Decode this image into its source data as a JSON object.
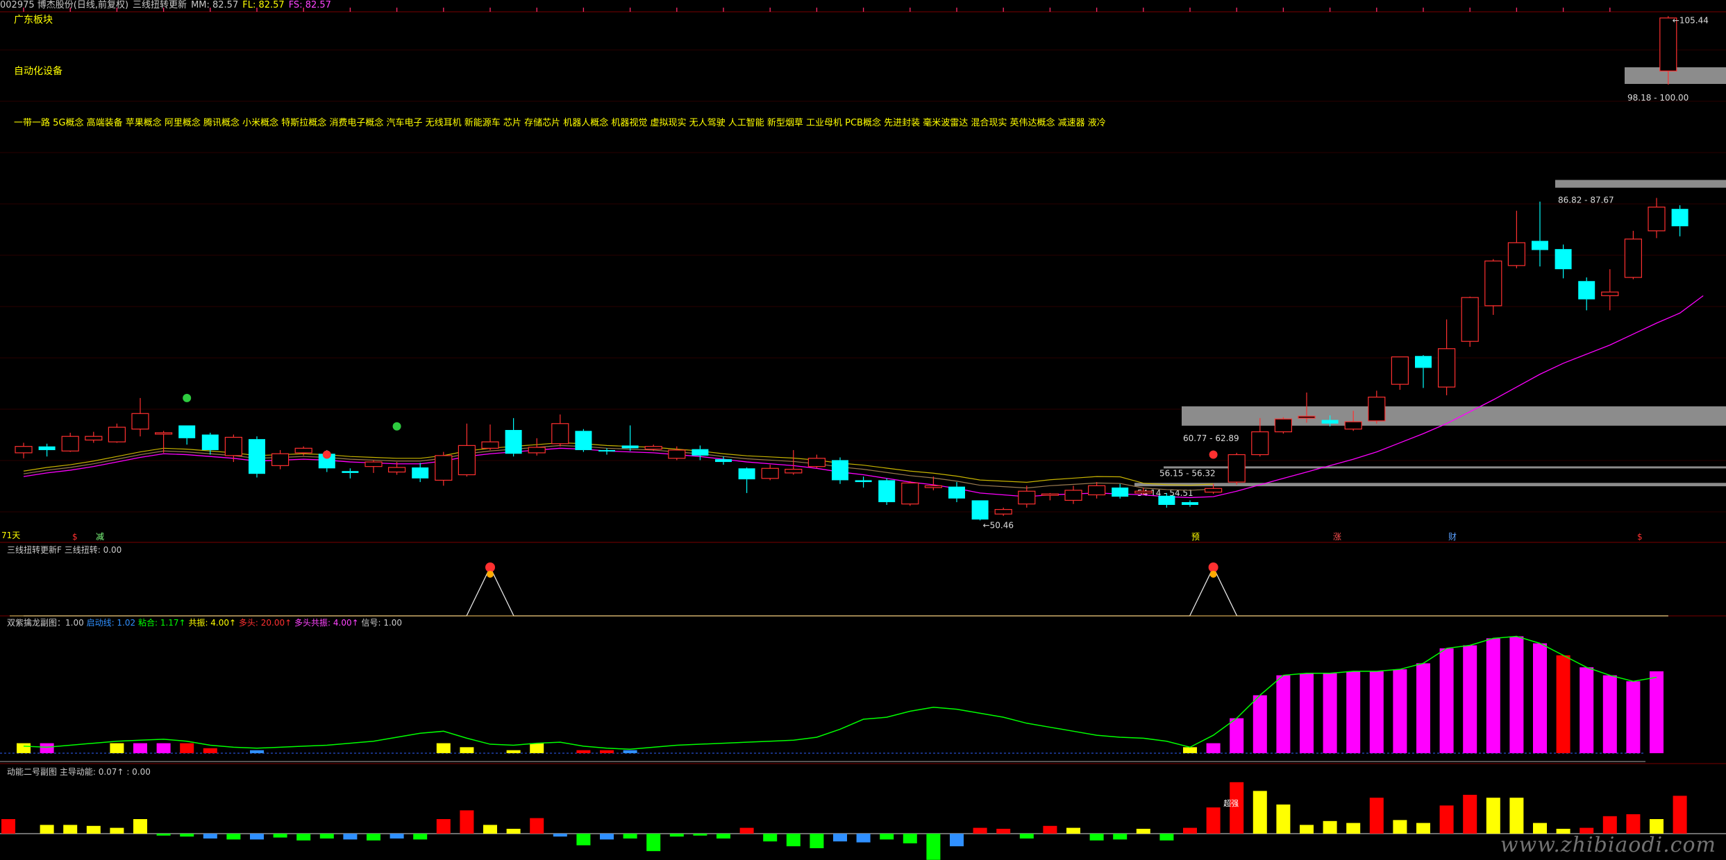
{
  "header": {
    "stock": "002975 博杰股份(日线,前复权)",
    "indicator": "三线扭转更新",
    "mm": "MM: 82.57",
    "fl": "FL: 82.57",
    "fs": "FS: 82.57",
    "arrow": "↑"
  },
  "tags": {
    "region": "广东板块",
    "industry": "自动化设备",
    "concepts": "一带一路 5G概念 高端装备 苹果概念 阿里概念 腾讯概念 小米概念 特斯拉概念 消费电子概念 汽车电子 无线耳机 新能源车 芯片 存储芯片 机器人概念 机器视觉 虚拟现实 无人驾驶 人工智能 新型烟草 工业母机 PCB概念 先进封装 毫米波雷达 混合现实 英伟达概念 减速器 液冷"
  },
  "price_labels": {
    "high": "105.44",
    "low": "50.46",
    "zone1": "98.18 - 100.00",
    "zone2": "86.82 - 87.67",
    "zone3": "60.77 - 62.89",
    "zone4": "56.15 - 56.32",
    "zone5": "54.14 - 54.51"
  },
  "event_labels": {
    "left": "71天",
    "e1": "$",
    "e2": "减",
    "e3": "预",
    "e4": "涨",
    "e5": "财",
    "e6": "$"
  },
  "panels": {
    "p2": {
      "name": "三线扭转更新F",
      "value": "三线扭转: 0.00"
    },
    "p3": {
      "name": "双紫擒龙副图：1.00",
      "a": "启动线: 1.02",
      "b": "粘合: 1.17↑",
      "c": "共振: 4.00↑",
      "d": "多头: 20.00↑",
      "e": "多头共振: 4.00↑",
      "f": "信号: 1.00"
    },
    "p4": {
      "name": "动能二号副图",
      "a": "主导动能: 0.07↑",
      "b": ": 0.00",
      "mark": "超强"
    }
  },
  "watermark": "www.zhibiaodi.com",
  "colors": {
    "up": "#ff3030",
    "down": "#00ffff",
    "ma": "#ff00ff",
    "yellow": "#ffff00",
    "green": "#00ff00",
    "magenta": "#ff00ff",
    "red": "#ff0000",
    "blue": "#3090ff",
    "zone": "#8c8c8c"
  },
  "chart_data": [
    {
      "type": "candlestick",
      "title": "002975 博杰股份(日线,前复权)",
      "ylim": [
        48,
        106
      ],
      "candles": [
        [
          57.8,
          58.5,
          57.2,
          58.9
        ],
        [
          58.5,
          58.1,
          57.4,
          58.8
        ],
        [
          58.0,
          59.6,
          57.9,
          60.0
        ],
        [
          59.2,
          59.6,
          58.9,
          60.1
        ],
        [
          59.0,
          60.6,
          58.9,
          61.0
        ],
        [
          60.4,
          62.1,
          59.6,
          63.8
        ],
        [
          59.9,
          60.0,
          57.8,
          60.2
        ],
        [
          60.8,
          59.4,
          58.7,
          60.8
        ],
        [
          59.8,
          58.1,
          57.6,
          60.0
        ],
        [
          57.5,
          59.5,
          56.8,
          59.8
        ],
        [
          59.3,
          55.5,
          55.1,
          59.6
        ],
        [
          56.4,
          57.7,
          56.0,
          58.1
        ],
        [
          57.8,
          58.3,
          57.5,
          58.5
        ],
        [
          57.7,
          56.1,
          55.7,
          58.1
        ],
        [
          55.8,
          55.6,
          55.0,
          56.1
        ],
        [
          56.3,
          56.8,
          55.6,
          57.0
        ],
        [
          55.7,
          56.2,
          55.4,
          56.8
        ],
        [
          56.2,
          55.0,
          54.6,
          56.7
        ],
        [
          54.8,
          57.5,
          54.2,
          57.9
        ],
        [
          55.4,
          58.6,
          55.2,
          61.0
        ],
        [
          58.3,
          59.0,
          58.1,
          60.9
        ],
        [
          60.3,
          57.7,
          57.4,
          61.6
        ],
        [
          57.8,
          58.4,
          57.5,
          59.4
        ],
        [
          58.8,
          61.0,
          58.5,
          62.0
        ],
        [
          60.2,
          58.1,
          57.9,
          60.4
        ],
        [
          58.1,
          58.0,
          57.6,
          58.3
        ],
        [
          58.6,
          58.3,
          58.0,
          60.8
        ],
        [
          58.2,
          58.5,
          58.0,
          58.7
        ],
        [
          57.2,
          58.1,
          57.0,
          58.5
        ],
        [
          58.2,
          57.5,
          57.0,
          58.6
        ],
        [
          57.1,
          56.8,
          56.5,
          57.4
        ],
        [
          56.1,
          54.9,
          53.4,
          56.2
        ],
        [
          55.0,
          56.1,
          54.8,
          56.5
        ],
        [
          55.6,
          56.0,
          55.4,
          58.1
        ],
        [
          56.3,
          57.2,
          56.1,
          57.6
        ],
        [
          57.0,
          54.8,
          54.4,
          57.3
        ],
        [
          54.8,
          54.6,
          54.0,
          55.2
        ],
        [
          54.8,
          52.4,
          52.1,
          55.0
        ],
        [
          52.2,
          54.5,
          52.0,
          54.7
        ],
        [
          54.0,
          54.2,
          53.7,
          55.2
        ],
        [
          54.1,
          52.8,
          52.4,
          54.6
        ],
        [
          52.6,
          50.5,
          50.4,
          52.6
        ],
        [
          51.1,
          51.6,
          50.9,
          51.8
        ],
        [
          52.2,
          53.6,
          51.8,
          54.2
        ],
        [
          53.2,
          53.3,
          52.6,
          53.4
        ],
        [
          52.6,
          53.7,
          52.2,
          54.2
        ],
        [
          53.2,
          54.2,
          52.8,
          54.6
        ],
        [
          54.0,
          53.0,
          52.8,
          54.4
        ],
        [
          53.4,
          53.6,
          53.2,
          54.0
        ],
        [
          53.1,
          52.1,
          51.8,
          53.4
        ],
        [
          52.4,
          52.1,
          51.9,
          52.6
        ],
        [
          53.5,
          53.9,
          53.3,
          54.4
        ],
        [
          54.6,
          57.6,
          54.3,
          57.8
        ],
        [
          57.6,
          60.1,
          57.4,
          61.6
        ],
        [
          60.1,
          61.5,
          59.9,
          61.7
        ],
        [
          61.6,
          61.8,
          61.1,
          64.4
        ],
        [
          61.4,
          61.0,
          60.7,
          61.9
        ],
        [
          60.4,
          61.2,
          60.2,
          62.4
        ],
        [
          61.3,
          63.9,
          61.0,
          64.6
        ],
        [
          65.3,
          68.3,
          64.7,
          68.3
        ],
        [
          68.4,
          67.1,
          64.9,
          68.5
        ],
        [
          65.0,
          69.2,
          64.1,
          72.4
        ],
        [
          70.0,
          74.8,
          69.4,
          74.9
        ],
        [
          73.9,
          78.8,
          72.9,
          79.0
        ],
        [
          78.3,
          80.8,
          78.0,
          84.3
        ],
        [
          81.0,
          80.0,
          78.2,
          85.3
        ],
        [
          80.1,
          77.9,
          76.9,
          80.6
        ],
        [
          76.6,
          74.6,
          73.4,
          77.0
        ],
        [
          75.0,
          75.4,
          73.4,
          77.9
        ],
        [
          77.0,
          81.2,
          76.8,
          82.1
        ],
        [
          82.1,
          84.7,
          81.3,
          85.7
        ],
        [
          84.5,
          82.6,
          81.5,
          84.9
        ],
        [
          99.6,
          105.4,
          98.1,
          105.6
        ]
      ],
      "ma_line": [
        55.2,
        55.6,
        55.9,
        56.3,
        56.8,
        57.3,
        57.7,
        57.6,
        57.4,
        57.2,
        56.9,
        57.0,
        57.1,
        57.0,
        56.8,
        56.7,
        56.6,
        56.6,
        56.9,
        57.4,
        57.7,
        57.9,
        58.1,
        58.3,
        58.2,
        58.0,
        57.9,
        57.8,
        57.6,
        57.4,
        57.1,
        56.8,
        56.6,
        56.4,
        56.1,
        55.7,
        55.4,
        55.0,
        54.6,
        54.3,
        53.9,
        53.4,
        53.2,
        53.0,
        53.2,
        53.3,
        53.4,
        53.3,
        53.2,
        53.0,
        52.9,
        53.0,
        53.6,
        54.3,
        55.0,
        55.7,
        56.4,
        57.1,
        57.9,
        58.9,
        59.9,
        61.0,
        62.3,
        63.6,
        65.0,
        66.4,
        67.6,
        68.6,
        69.6,
        70.8,
        72.0,
        73.1,
        75.0
      ],
      "zones": [
        {
          "label": "98.18 - 100.00",
          "from": 98.18,
          "to": 100.0
        },
        {
          "label": "86.82 - 87.67",
          "from": 86.82,
          "to": 87.67
        },
        {
          "label": "60.77 - 62.89",
          "from": 60.77,
          "to": 62.89
        },
        {
          "label": "56.15 - 56.32",
          "from": 56.15,
          "to": 56.32
        },
        {
          "label": "54.14 - 54.51",
          "from": 54.14,
          "to": 54.51
        }
      ]
    },
    {
      "type": "line",
      "title": "三线扭转更新F",
      "signal_indices": [
        20,
        51
      ],
      "signal_value": 1.0
    },
    {
      "type": "bar",
      "title": "双紫擒龙副图",
      "bars": [
        [
          1.0,
          "yellow"
        ],
        [
          1.0,
          "magenta"
        ],
        [
          0,
          ""
        ],
        [
          0,
          ""
        ],
        [
          1.0,
          "yellow"
        ],
        [
          1.0,
          "magenta"
        ],
        [
          1.0,
          "magenta"
        ],
        [
          1.0,
          "red"
        ],
        [
          0.5,
          "red"
        ],
        [
          0,
          ""
        ],
        [
          0.3,
          "blue"
        ],
        [
          0,
          ""
        ],
        [
          0,
          ""
        ],
        [
          0,
          ""
        ],
        [
          0,
          ""
        ],
        [
          0,
          ""
        ],
        [
          0,
          ""
        ],
        [
          0,
          ""
        ],
        [
          1.0,
          "yellow"
        ],
        [
          0.6,
          "yellow"
        ],
        [
          0,
          ""
        ],
        [
          0.3,
          "yellow"
        ],
        [
          1.0,
          "yellow"
        ],
        [
          0,
          ""
        ],
        [
          0.3,
          "red"
        ],
        [
          0.3,
          "red"
        ],
        [
          0.3,
          "blue"
        ],
        [
          0,
          ""
        ],
        [
          0,
          ""
        ],
        [
          0,
          ""
        ],
        [
          0,
          ""
        ],
        [
          0,
          ""
        ],
        [
          0,
          ""
        ],
        [
          0,
          ""
        ],
        [
          0,
          ""
        ],
        [
          0,
          ""
        ],
        [
          0,
          ""
        ],
        [
          0,
          ""
        ],
        [
          0,
          ""
        ],
        [
          0,
          ""
        ],
        [
          0,
          ""
        ],
        [
          0,
          ""
        ],
        [
          0,
          ""
        ],
        [
          0,
          ""
        ],
        [
          0,
          ""
        ],
        [
          0,
          ""
        ],
        [
          0,
          ""
        ],
        [
          0,
          ""
        ],
        [
          0,
          ""
        ],
        [
          0,
          ""
        ],
        [
          0.6,
          "yellow"
        ],
        [
          1.0,
          "magenta"
        ],
        [
          3.5,
          "magenta"
        ],
        [
          5.8,
          "magenta"
        ],
        [
          7.8,
          "magenta"
        ],
        [
          8.0,
          "magenta"
        ],
        [
          8.0,
          "magenta"
        ],
        [
          8.2,
          "magenta"
        ],
        [
          8.2,
          "magenta"
        ],
        [
          8.4,
          "magenta"
        ],
        [
          9.0,
          "magenta"
        ],
        [
          10.5,
          "magenta"
        ],
        [
          10.8,
          "magenta"
        ],
        [
          11.5,
          "magenta"
        ],
        [
          11.7,
          "magenta"
        ],
        [
          11.0,
          "magenta"
        ],
        [
          9.8,
          "red"
        ],
        [
          8.6,
          "magenta"
        ],
        [
          7.8,
          "magenta"
        ],
        [
          7.2,
          "magenta"
        ],
        [
          8.2,
          "magenta"
        ]
      ],
      "line": [
        0.7,
        0.6,
        0.8,
        1.0,
        1.2,
        1.3,
        1.4,
        1.2,
        0.8,
        0.6,
        0.5,
        0.6,
        0.7,
        0.8,
        1.0,
        1.2,
        1.6,
        2.0,
        2.2,
        1.5,
        0.9,
        0.8,
        1.0,
        1.1,
        0.7,
        0.5,
        0.4,
        0.6,
        0.8,
        0.9,
        1.0,
        1.1,
        1.2,
        1.3,
        1.6,
        2.4,
        3.4,
        3.6,
        4.2,
        4.6,
        4.4,
        4.0,
        3.6,
        3.0,
        2.6,
        2.2,
        1.8,
        1.6,
        1.5,
        1.2,
        0.6,
        1.8,
        3.5,
        5.8,
        7.8,
        8.0,
        8.0,
        8.2,
        8.2,
        8.4,
        9.0,
        10.5,
        10.8,
        11.5,
        11.7,
        11.0,
        9.8,
        8.6,
        7.8,
        7.2,
        7.6
      ],
      "ylim": [
        0,
        12.5
      ]
    },
    {
      "type": "bar",
      "title": "动能二号副图",
      "bars": [
        [
          1.5,
          "red"
        ],
        [
          0.9,
          "yellow"
        ],
        [
          0.9,
          "yellow"
        ],
        [
          0.8,
          "yellow"
        ],
        [
          0.6,
          "yellow"
        ],
        [
          1.5,
          "yellow"
        ],
        [
          -0.2,
          "green"
        ],
        [
          -0.3,
          "green"
        ],
        [
          -0.5,
          "blue"
        ],
        [
          -0.6,
          "green"
        ],
        [
          -0.6,
          "blue"
        ],
        [
          -0.4,
          "green"
        ],
        [
          -0.7,
          "green"
        ],
        [
          -0.5,
          "green"
        ],
        [
          -0.6,
          "blue"
        ],
        [
          -0.7,
          "green"
        ],
        [
          -0.5,
          "blue"
        ],
        [
          -0.6,
          "green"
        ],
        [
          1.5,
          "red"
        ],
        [
          2.4,
          "red"
        ],
        [
          0.9,
          "yellow"
        ],
        [
          0.5,
          "yellow"
        ],
        [
          1.6,
          "red"
        ],
        [
          -0.3,
          "blue"
        ],
        [
          -1.2,
          "green"
        ],
        [
          -0.6,
          "blue"
        ],
        [
          -0.5,
          "green"
        ],
        [
          -1.8,
          "green"
        ],
        [
          -0.3,
          "green"
        ],
        [
          -0.2,
          "green"
        ],
        [
          -0.5,
          "green"
        ],
        [
          0.6,
          "red"
        ],
        [
          -0.8,
          "green"
        ],
        [
          -1.3,
          "green"
        ],
        [
          -1.5,
          "green"
        ],
        [
          -0.8,
          "blue"
        ],
        [
          -0.9,
          "blue"
        ],
        [
          -0.6,
          "green"
        ],
        [
          -1.0,
          "green"
        ],
        [
          -2.7,
          "green"
        ],
        [
          -1.3,
          "blue"
        ],
        [
          0.6,
          "red"
        ],
        [
          0.5,
          "red"
        ],
        [
          -0.5,
          "green"
        ],
        [
          0.8,
          "red"
        ],
        [
          0.6,
          "yellow"
        ],
        [
          -0.7,
          "green"
        ],
        [
          -0.6,
          "green"
        ],
        [
          0.5,
          "yellow"
        ],
        [
          -0.7,
          "green"
        ],
        [
          0.6,
          "red"
        ],
        [
          2.7,
          "red"
        ],
        [
          5.3,
          "red"
        ],
        [
          4.4,
          "yellow"
        ],
        [
          3.0,
          "yellow"
        ],
        [
          0.9,
          "yellow"
        ],
        [
          1.3,
          "yellow"
        ],
        [
          1.1,
          "yellow"
        ],
        [
          3.7,
          "red"
        ],
        [
          1.4,
          "yellow"
        ],
        [
          1.1,
          "yellow"
        ],
        [
          2.9,
          "red"
        ],
        [
          4.0,
          "red"
        ],
        [
          3.7,
          "yellow"
        ],
        [
          3.7,
          "yellow"
        ],
        [
          1.1,
          "yellow"
        ],
        [
          0.5,
          "yellow"
        ],
        [
          0.6,
          "red"
        ],
        [
          1.8,
          "red"
        ],
        [
          2.0,
          "red"
        ],
        [
          1.5,
          "yellow"
        ],
        [
          3.9,
          "red"
        ]
      ],
      "ylim": [
        -3,
        6
      ]
    }
  ]
}
